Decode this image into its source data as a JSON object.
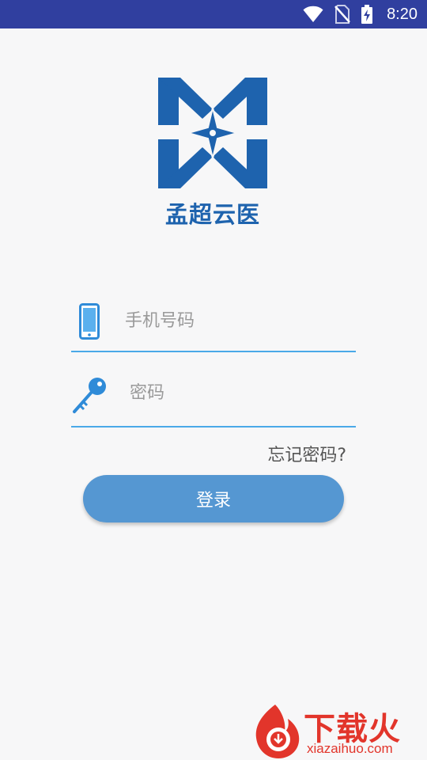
{
  "status_bar": {
    "time": "8:20",
    "icons": [
      "wifi-icon",
      "no-sim-icon",
      "battery-charging-icon"
    ]
  },
  "brand": {
    "name": "孟超云医",
    "logo_icon": "mc-star-logo-icon",
    "color": "#1e63ae"
  },
  "form": {
    "phone": {
      "placeholder": "手机号码",
      "icon": "phone-icon"
    },
    "password": {
      "placeholder": "密码",
      "icon": "key-icon"
    },
    "forgot_label": "忘记密码?",
    "login_label": "登录",
    "accent": "#4aa9e8",
    "button_color": "#5597d2"
  },
  "watermark": {
    "text": "下载火",
    "url": "xiazaihuo.com",
    "color": "#e2352b"
  }
}
